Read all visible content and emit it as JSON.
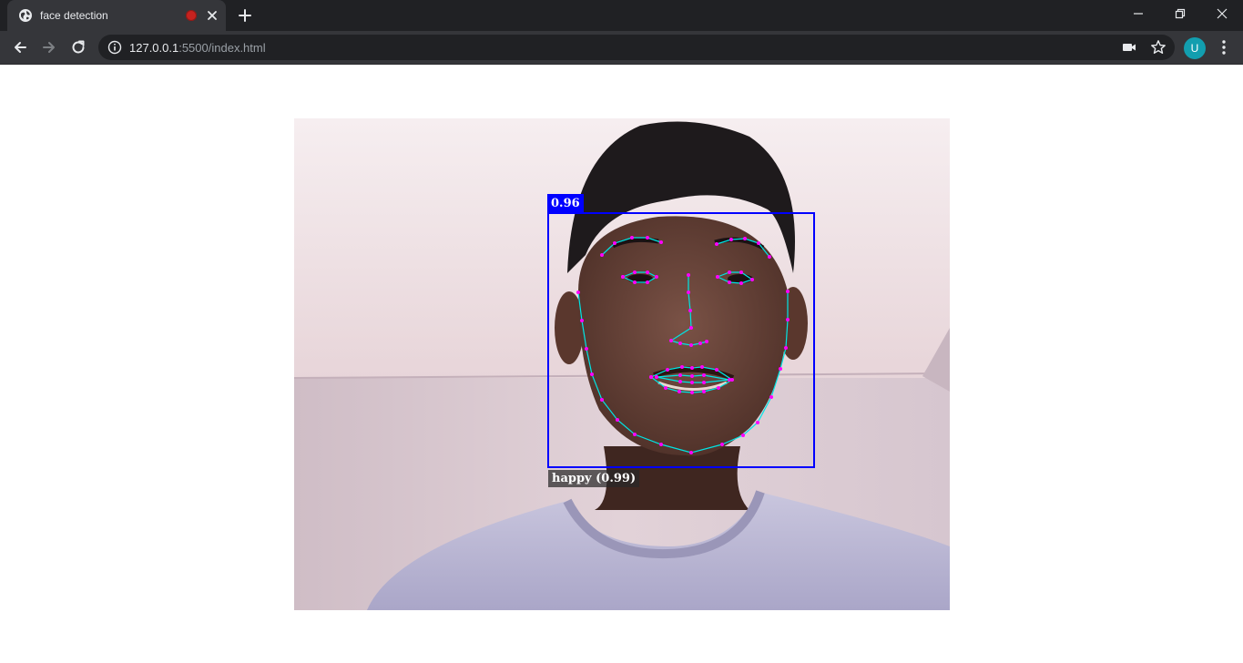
{
  "tab": {
    "title": "face detection",
    "favicon": "globe-icon",
    "recording_indicator_color": "#c5221f"
  },
  "toolbar": {
    "url_host": "127.0.0.1",
    "url_rest": ":5500/index.html",
    "profile_initial": "U",
    "profile_color": "#129eaf"
  },
  "detection": {
    "score_label": "0.96",
    "expression_label": "happy (0.99)",
    "box_color": "#0000ff",
    "landmark_line_color": "#00e5e5",
    "landmark_point_color": "#ff00ff"
  }
}
